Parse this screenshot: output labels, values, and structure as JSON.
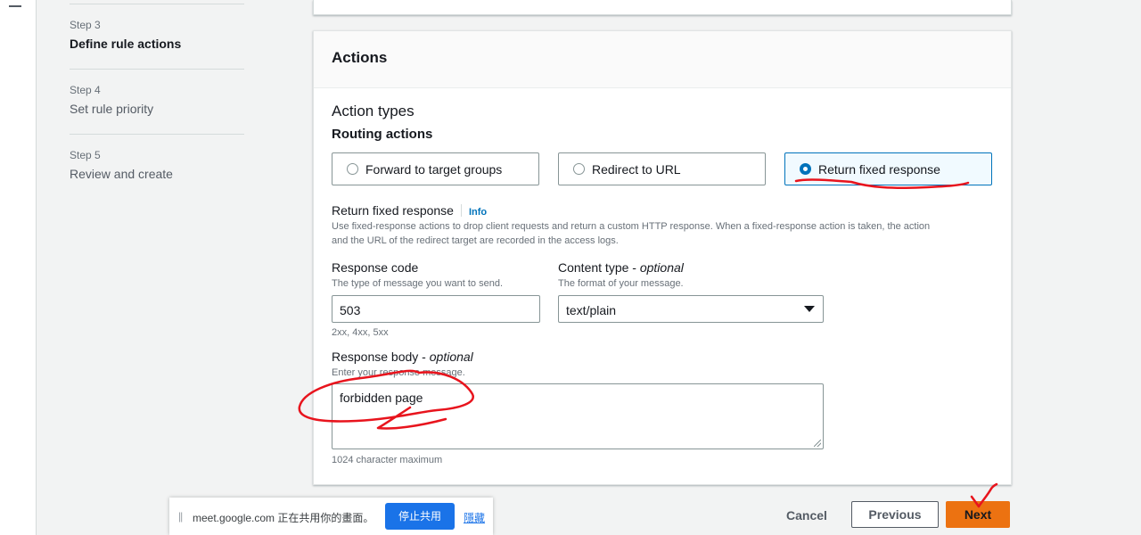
{
  "steps": [
    {
      "num": "Step 3",
      "title": "Define rule actions",
      "active": true
    },
    {
      "num": "Step 4",
      "title": "Set rule priority",
      "active": false
    },
    {
      "num": "Step 5",
      "title": "Review and create",
      "active": false
    }
  ],
  "panel": {
    "title": "Actions",
    "action_types_heading": "Action types",
    "routing_heading": "Routing actions",
    "options": [
      {
        "label": "Forward to target groups",
        "selected": false
      },
      {
        "label": "Redirect to URL",
        "selected": false
      },
      {
        "label": "Return fixed response",
        "selected": true
      }
    ],
    "fixed_response": {
      "label": "Return fixed response",
      "info": "Info",
      "description_line1": "Use fixed-response actions to drop client requests and return a custom HTTP response. When a fixed-response action is taken, the action",
      "description_line2": "and the URL of the redirect target are recorded in the access logs."
    },
    "response_code": {
      "label": "Response code",
      "description": "The type of message you want to send.",
      "value": "503",
      "hint": "2xx, 4xx, 5xx"
    },
    "content_type": {
      "label": "Content type",
      "optional": "optional",
      "description": "The format of your message.",
      "value": "text/plain"
    },
    "response_body": {
      "label": "Response body",
      "optional": "optional",
      "description": "Enter your response message.",
      "value": "forbidden page",
      "hint": "1024 character maximum"
    }
  },
  "footer": {
    "cancel": "Cancel",
    "previous": "Previous",
    "next": "Next"
  },
  "share_bar": {
    "handle": "||",
    "text": "meet.google.com 正在共用你的畫面。",
    "stop": "停止共用",
    "hide": "隱藏"
  },
  "colors": {
    "accent": "#0073bb",
    "primary_button": "#ec7211",
    "annotation": "#e8141d"
  }
}
